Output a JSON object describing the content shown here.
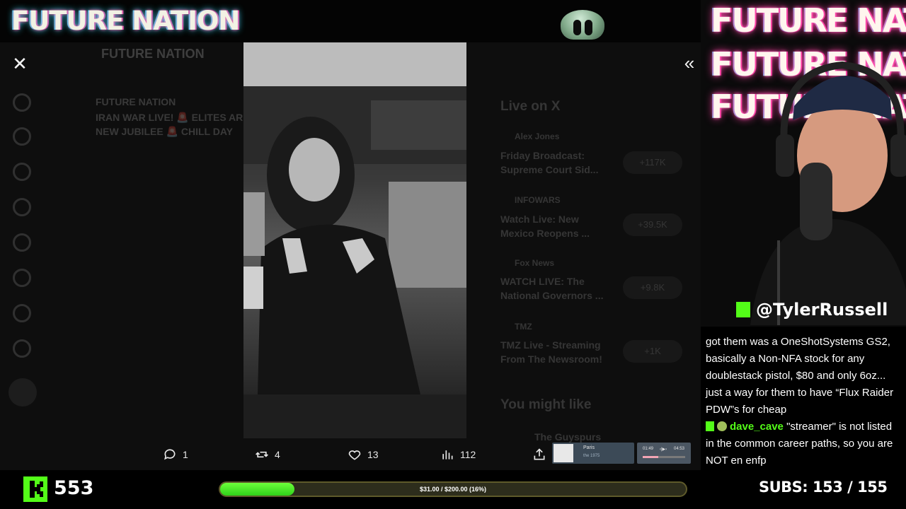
{
  "header": {
    "brand": "FUTURE NATION"
  },
  "background": {
    "profile_name": "FUTURE NATION",
    "post_author": "FUTURE NATION",
    "post_line1": "IRAN WAR LIVE! 🚨 ELITES AR",
    "post_line2": "NEW JUBILEE 🚨 CHILL DAY",
    "live_heading": "Live on X",
    "live_items": [
      {
        "host": "Alex Jones",
        "title1": "Friday Broadcast:",
        "title2": "Supreme Court Sid...",
        "count": "+117K"
      },
      {
        "host": "INFOWARS",
        "title1": "Watch Live: New",
        "title2": "Mexico Reopens ...",
        "count": "+39.5K"
      },
      {
        "host": "Fox News",
        "title1": "WATCH LIVE: The",
        "title2": "National Governors ...",
        "count": "+9.8K"
      },
      {
        "host": "TMZ",
        "title1": "TMZ Live - Streaming",
        "title2": "From The Newsroom!",
        "count": "+1K"
      }
    ],
    "might_like_heading": "You might like",
    "suggested_name": "The Guyspurs"
  },
  "viewer": {
    "actions": {
      "replies": "1",
      "reposts": "4",
      "likes": "13",
      "views": "112"
    },
    "media_title": "Paris",
    "media_subtitle": "the 1975",
    "player_elapsed": "01:49",
    "player_total": "04:53",
    "player_progress": 0.37
  },
  "webcam": {
    "neon_lines": [
      "FUTURE NATION",
      "FUTURE NATION",
      "FUTURE NATION"
    ],
    "handle": "@TylerRussell"
  },
  "chat": {
    "message1_text": "got them was a OneShotSystems GS2, basically a Non-NFA stock for any doublestack pistol, $80 and only 6oz... just a way for them to have “Flux Raider PDW”s for cheap",
    "message2_user": "dave_cave",
    "message2_text": " \"streamer\" is not listed in the common career paths, so you are NOT en enfp"
  },
  "stats": {
    "viewer_count": "553",
    "goal_text": "$31.00 / $200.00 (16%)",
    "goal_fraction": 0.16,
    "subs_label": "SUBS:",
    "subs_value": "153 / 155"
  },
  "colors": {
    "kick_green": "#53fc18",
    "goal_fill": "#3fe51f"
  }
}
